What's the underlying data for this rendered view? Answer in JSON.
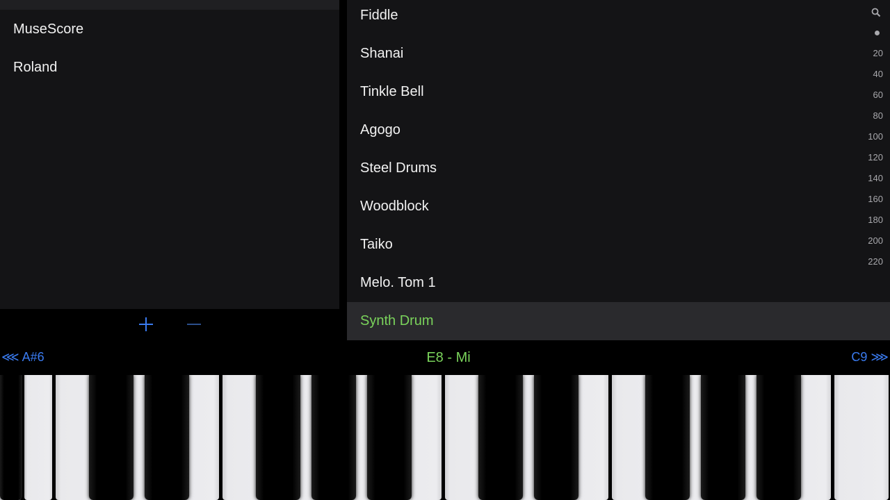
{
  "soundfonts": {
    "items": [
      "MuseScore",
      "Roland"
    ],
    "add_label": "+",
    "remove_label": "−"
  },
  "instruments": {
    "items": [
      "Fiddle",
      "Shanai",
      "Tinkle Bell",
      "Agogo",
      "Steel Drums",
      "Woodblock",
      "Taiko",
      "Melo. Tom 1",
      "Synth Drum"
    ],
    "selected_index": 8
  },
  "index_bar": {
    "search_icon": "search-icon",
    "items": [
      "20",
      "40",
      "60",
      "80",
      "100",
      "120",
      "140",
      "160",
      "180",
      "200",
      "220"
    ]
  },
  "keyboard_nav": {
    "prev": "⋘ A#6",
    "current": "E8 - Mi",
    "next": "C9 ⋙"
  },
  "colors": {
    "accent_blue": "#3a7bf0",
    "selected_green": "#7ad35b",
    "panel_bg": "#141416"
  }
}
